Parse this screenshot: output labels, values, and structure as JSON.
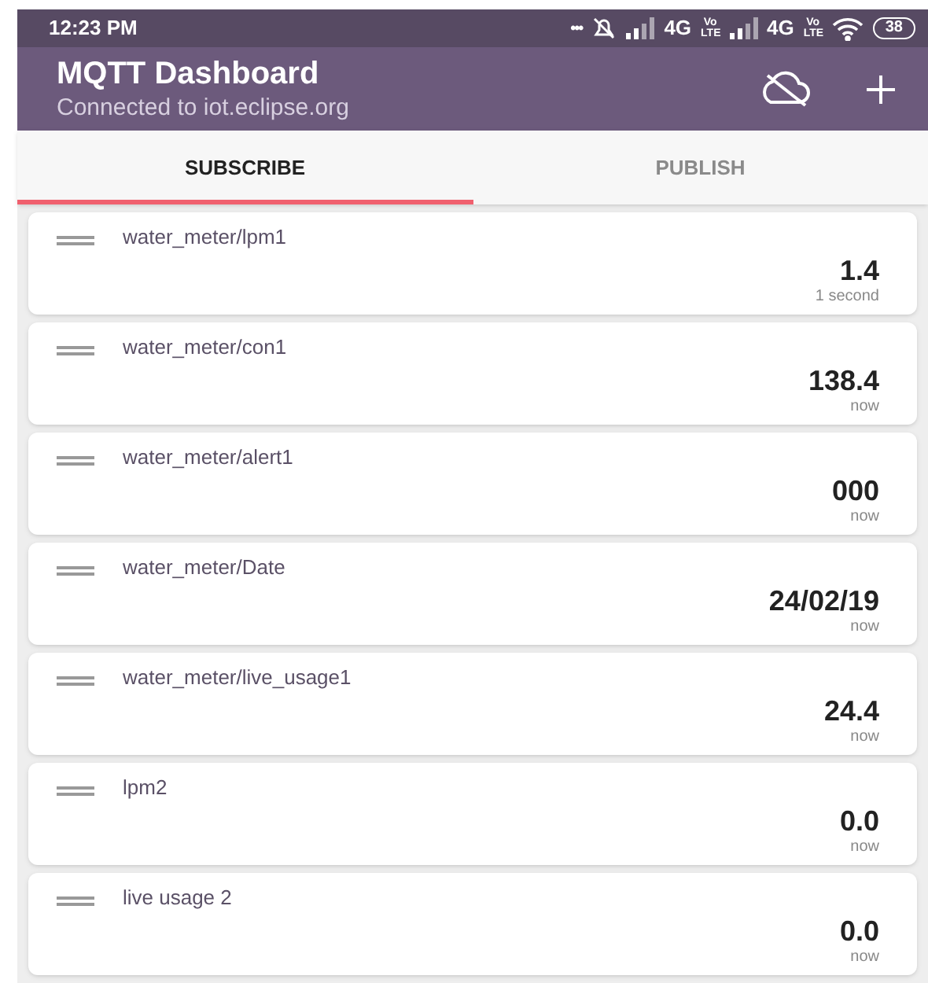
{
  "status_bar": {
    "time": "12:23 PM",
    "indicators": [
      {
        "kind": "dots",
        "text": "•••"
      },
      {
        "kind": "alarm_off"
      },
      {
        "kind": "signal"
      },
      {
        "kind": "text",
        "text": "4G"
      },
      {
        "kind": "volte",
        "text": "Vo LTE"
      },
      {
        "kind": "signal"
      },
      {
        "kind": "text",
        "text": "4G"
      },
      {
        "kind": "volte",
        "text": "Vo LTE"
      },
      {
        "kind": "wifi"
      },
      {
        "kind": "battery",
        "text": "38"
      }
    ]
  },
  "app_bar": {
    "title": "MQTT Dashboard",
    "subtitle": "Connected to iot.eclipse.org"
  },
  "tabs": [
    {
      "label": "SUBSCRIBE",
      "selected": true
    },
    {
      "label": "PUBLISH",
      "selected": false
    }
  ],
  "subscriptions": [
    {
      "topic": "water_meter/lpm1",
      "value": "1.4",
      "time": "1 second"
    },
    {
      "topic": "water_meter/con1",
      "value": "138.4",
      "time": "now"
    },
    {
      "topic": "water_meter/alert1",
      "value": "000",
      "time": "now"
    },
    {
      "topic": "water_meter/Date",
      "value": "24/02/19",
      "time": "now"
    },
    {
      "topic": "water_meter/live_usage1",
      "value": "24.4",
      "time": "now"
    },
    {
      "topic": "lpm2",
      "value": "0.0",
      "time": "now"
    },
    {
      "topic": "live usage 2",
      "value": "0.0",
      "time": "now"
    }
  ]
}
